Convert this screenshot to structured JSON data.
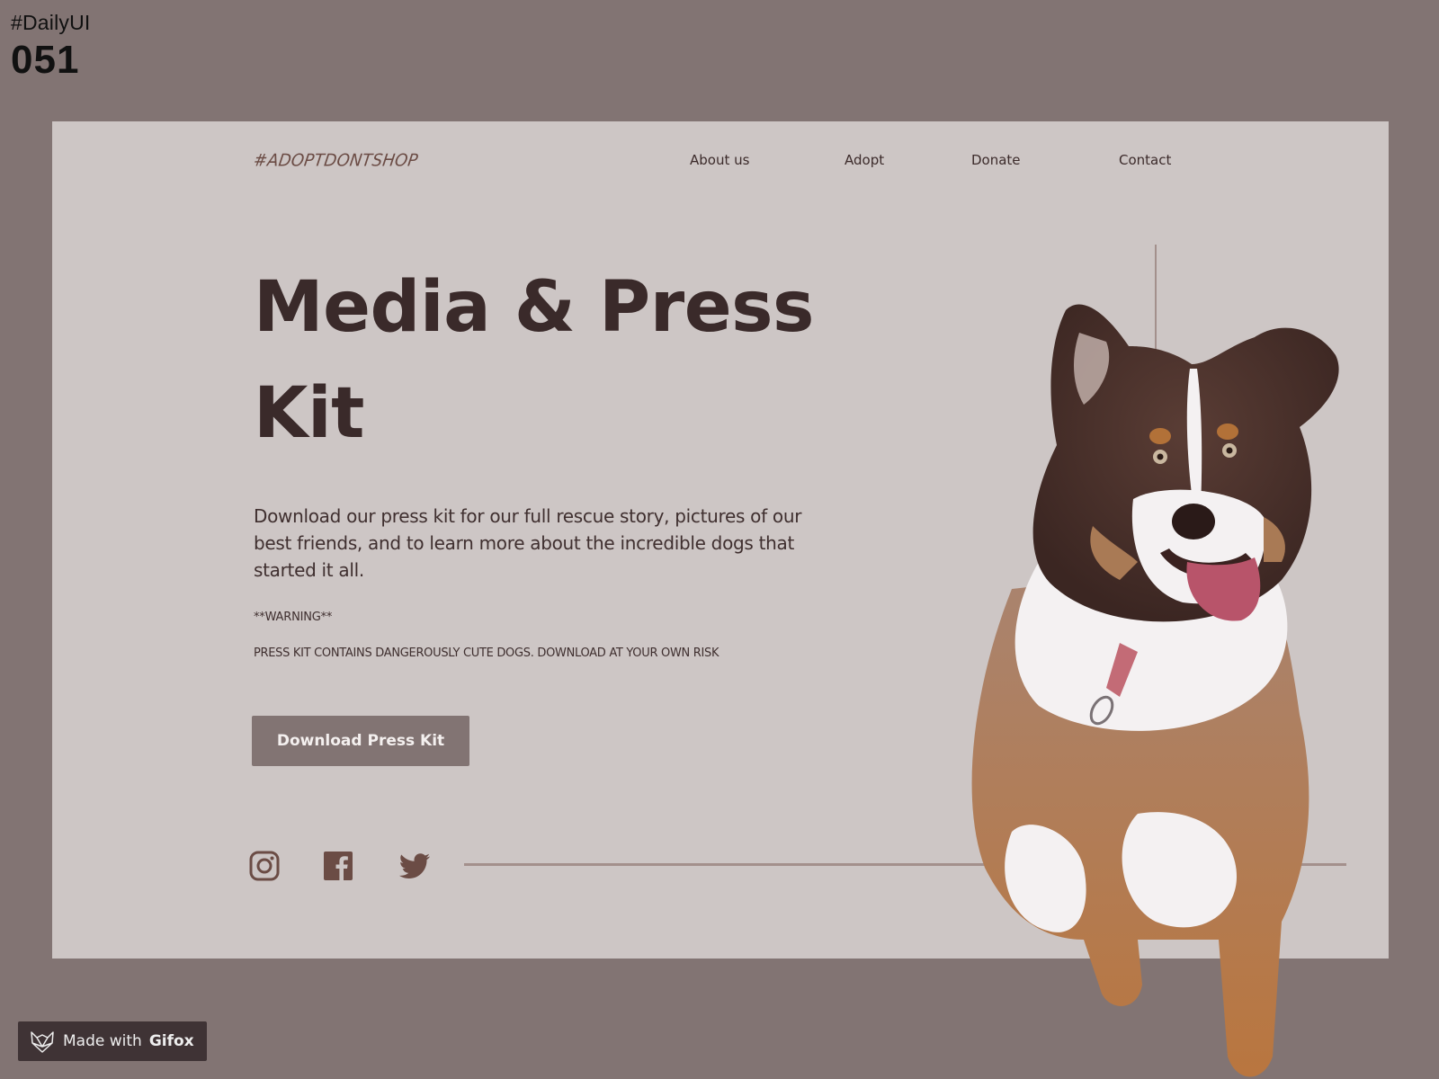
{
  "overlay": {
    "tag": "#DailyUI",
    "number": "051"
  },
  "header": {
    "logo": "#ADOPTDONTSHOP",
    "nav": [
      {
        "label": "About us"
      },
      {
        "label": "Adopt"
      },
      {
        "label": "Donate"
      },
      {
        "label": "Contact"
      }
    ]
  },
  "hero": {
    "title_line1": "Media & Press",
    "title_line2": "Kit",
    "intro": "Download our press kit for our full rescue story, pictures of our best friends, and to learn more about the incredible dogs that started it all.",
    "warning_label": "**WARNING**",
    "warning_text": "PRESS KIT CONTAINS DANGEROUSLY CUTE DOGS. DOWNLOAD AT YOUR OWN RISK",
    "button_label": "Download Press Kit"
  },
  "social": {
    "icons": [
      "instagram-icon",
      "facebook-icon",
      "twitter-icon"
    ]
  },
  "watermark": {
    "prefix": "Made with",
    "brand": "Gifox"
  },
  "colors": {
    "background": "#827473",
    "card": "#cdc6c5",
    "text": "#3a2a2a",
    "accent": "#6b4c45",
    "button": "#827473",
    "line": "#a3908c"
  }
}
